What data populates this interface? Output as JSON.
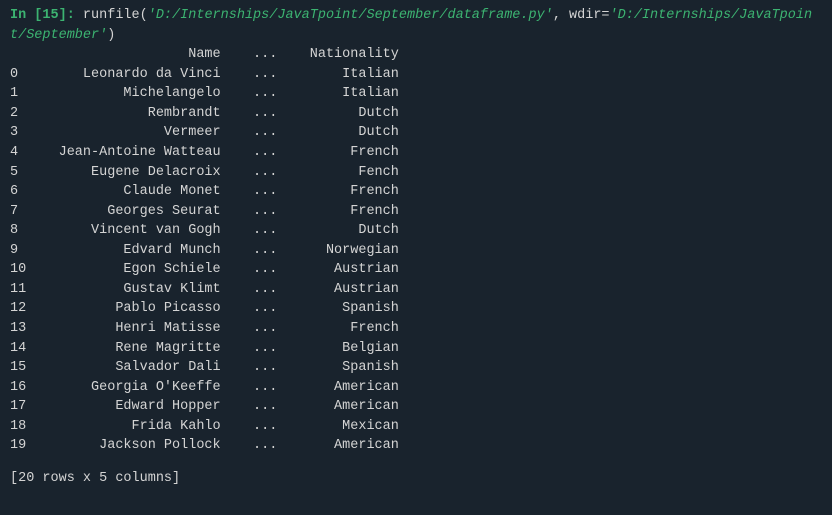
{
  "prompt": {
    "label": "In [",
    "number": "15",
    "close": "]: "
  },
  "command": {
    "func": "runfile(",
    "arg1": "'D:/Internships/JavaTpoint/September/dataframe.py'",
    "sep": ", ",
    "kwname": "wdir=",
    "arg2": "'D:/Internships/JavaTpoint/September'",
    "close": ")"
  },
  "table": {
    "header": {
      "name": "Name",
      "dots": "...",
      "nationality": "Nationality"
    },
    "rows": [
      {
        "idx": "0",
        "name": "Leonardo da Vinci",
        "dots": "...",
        "nat": "Italian"
      },
      {
        "idx": "1",
        "name": "Michelangelo",
        "dots": "...",
        "nat": "Italian"
      },
      {
        "idx": "2",
        "name": "Rembrandt",
        "dots": "...",
        "nat": "Dutch"
      },
      {
        "idx": "3",
        "name": "Vermeer",
        "dots": "...",
        "nat": "Dutch"
      },
      {
        "idx": "4",
        "name": "Jean-Antoine Watteau",
        "dots": "...",
        "nat": "French"
      },
      {
        "idx": "5",
        "name": "Eugene Delacroix",
        "dots": "...",
        "nat": "Fench"
      },
      {
        "idx": "6",
        "name": "Claude Monet",
        "dots": "...",
        "nat": "French"
      },
      {
        "idx": "7",
        "name": "Georges Seurat",
        "dots": "...",
        "nat": "French"
      },
      {
        "idx": "8",
        "name": "Vincent van Gogh",
        "dots": "...",
        "nat": "Dutch"
      },
      {
        "idx": "9",
        "name": "Edvard Munch",
        "dots": "...",
        "nat": "Norwegian"
      },
      {
        "idx": "10",
        "name": "Egon Schiele",
        "dots": "...",
        "nat": "Austrian"
      },
      {
        "idx": "11",
        "name": "Gustav Klimt",
        "dots": "...",
        "nat": "Austrian"
      },
      {
        "idx": "12",
        "name": "Pablo Picasso",
        "dots": "...",
        "nat": "Spanish"
      },
      {
        "idx": "13",
        "name": "Henri Matisse",
        "dots": "...",
        "nat": "French"
      },
      {
        "idx": "14",
        "name": "Rene Magritte",
        "dots": "...",
        "nat": "Belgian"
      },
      {
        "idx": "15",
        "name": "Salvador Dali",
        "dots": "...",
        "nat": "Spanish"
      },
      {
        "idx": "16",
        "name": "Georgia O'Keeffe",
        "dots": "...",
        "nat": "American"
      },
      {
        "idx": "17",
        "name": "Edward Hopper",
        "dots": "...",
        "nat": "American"
      },
      {
        "idx": "18",
        "name": "Frida Kahlo",
        "dots": "...",
        "nat": "Mexican"
      },
      {
        "idx": "19",
        "name": "Jackson Pollock",
        "dots": "...",
        "nat": "American"
      }
    ]
  },
  "footer": "[20 rows x 5 columns]",
  "widths": {
    "idx": 2,
    "name": 22,
    "dots": 5,
    "nat": 13
  }
}
